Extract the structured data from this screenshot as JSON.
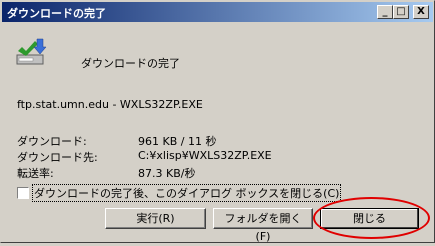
{
  "window": {
    "title": "ダウンロードの完了",
    "controls": [
      "_",
      "□",
      "X"
    ]
  },
  "icon": "download-complete-icon",
  "status_text": "ダウンロードの完了",
  "url": "ftp.stat.umn.edu - WXLS32ZP.EXE",
  "details": {
    "downloaded_label": "ダウンロード:",
    "downloaded_value": "961 KB / 11 秒",
    "destination_label": "ダウンロード先:",
    "destination_value": "C:¥xlisp¥WXLS32ZP.EXE",
    "rate_label": "転送率:",
    "rate_value": "87.3 KB/秒"
  },
  "checkbox": {
    "label": "ダウンロードの完了後、このダイアログ ボックスを閉じる(C)",
    "checked": false
  },
  "buttons": {
    "run": "実行(R)",
    "open_folder": "フォルダを開く(F)",
    "close": "閉じる"
  },
  "annotation_color": "#e00000"
}
